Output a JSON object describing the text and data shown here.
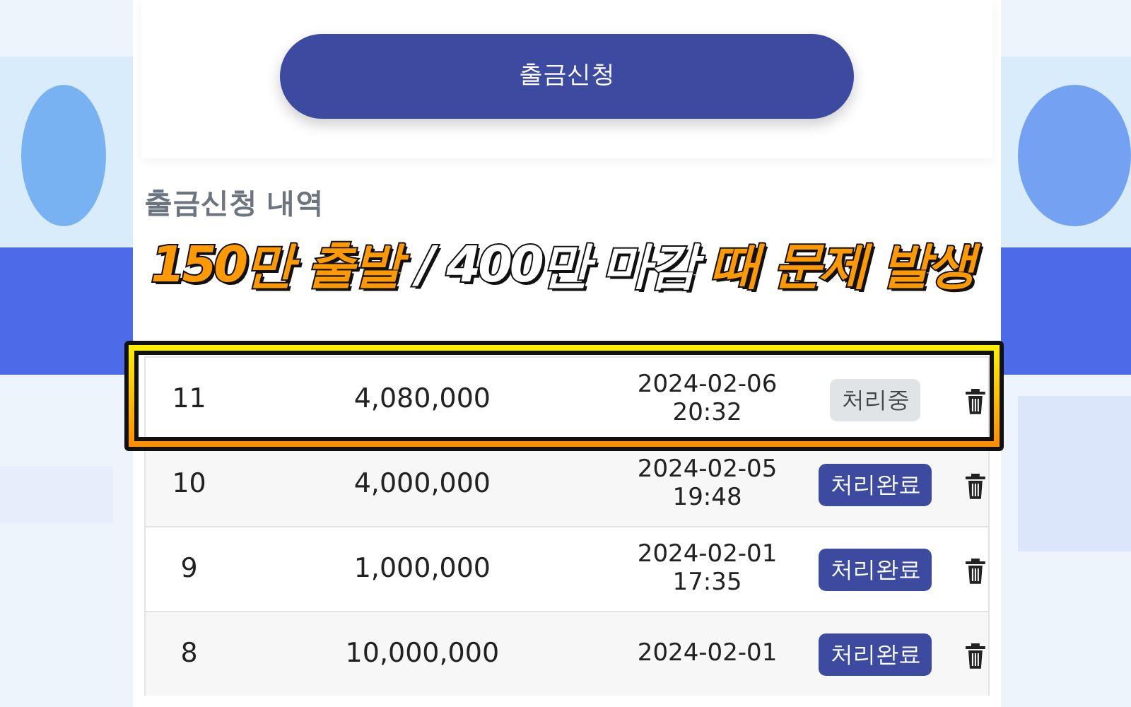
{
  "withdraw_button": "출금신청",
  "section_title": "출금신청 내역",
  "caption": [
    {
      "text": "150만 출발",
      "color": "#ff9900"
    },
    {
      "text": "/ 400만 마감",
      "color": "#ffffff"
    },
    {
      "text": "때 문제 발생",
      "color": "#ff9900"
    }
  ],
  "rows": [
    {
      "number": "11",
      "amount": "4,080,000",
      "date": "2024-02-06",
      "time": "20:32",
      "status": "처리중",
      "kind": "pending",
      "highlighted": true
    },
    {
      "number": "10",
      "amount": "4,000,000",
      "date": "2024-02-05",
      "time": "19:48",
      "status": "처리완료",
      "kind": "done",
      "highlighted": false
    },
    {
      "number": "9",
      "amount": "1,000,000",
      "date": "2024-02-01",
      "time": "17:35",
      "status": "처리완료",
      "kind": "done",
      "highlighted": false
    },
    {
      "number": "8",
      "amount": "10,000,000",
      "date": "2024-02-01",
      "status": "처리완료",
      "kind": "done",
      "highlighted": false
    }
  ]
}
